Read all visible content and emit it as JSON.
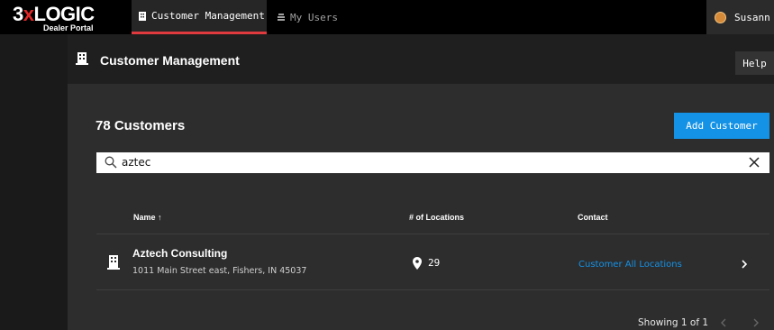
{
  "brand": {
    "logo_prefix": "3",
    "logo_x": "x",
    "logo_suffix": "LOGIC",
    "portal": "Dealer Portal",
    "accent_color": "#e0393e",
    "link_color": "#1492e6"
  },
  "nav": {
    "tabs": [
      {
        "label": "Customer Management",
        "icon": "building-icon",
        "active": true
      },
      {
        "label": "My Users",
        "icon": "users-icon",
        "active": false
      }
    ],
    "user_name": "Susann"
  },
  "page": {
    "title": "Customer Management",
    "help_label": "Help"
  },
  "main": {
    "count_title": "78 Customers",
    "add_button": "Add Customer",
    "search_value": "aztec",
    "columns": {
      "name": "Name ↑",
      "locations": "# of Locations",
      "contact": "Contact"
    },
    "rows": [
      {
        "name": "Aztech Consulting",
        "address": "1011 Main Street east, Fishers, IN 45037",
        "locations": "29",
        "contact": "Customer All Locations"
      }
    ],
    "pagination": "Showing 1 of 1"
  }
}
